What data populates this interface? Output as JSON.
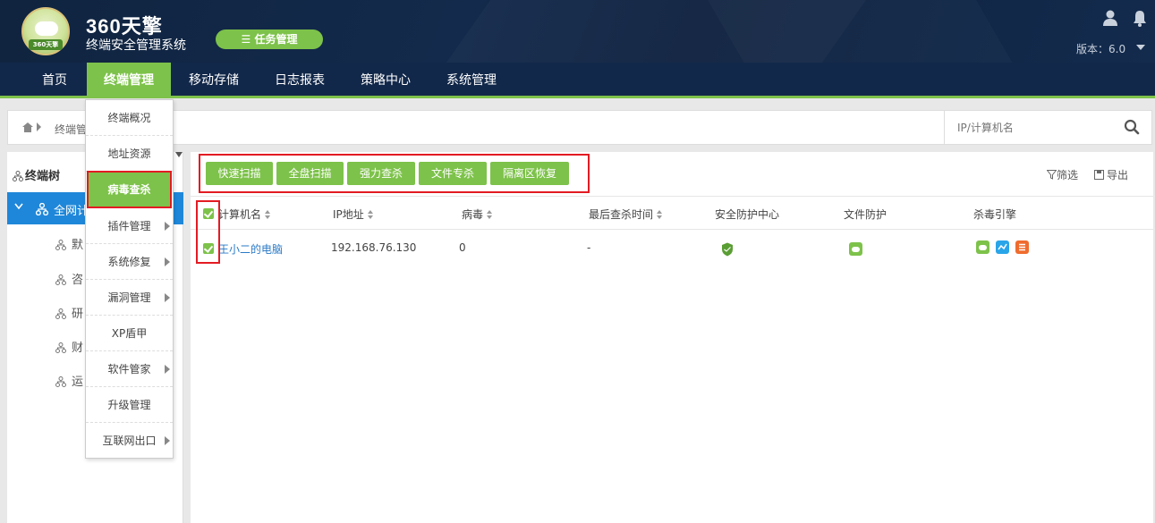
{
  "header": {
    "brand_main": "360天擎",
    "brand_sub": "终端安全管理系统",
    "badge_text": "360天擎",
    "task_button": "任务管理",
    "version": "版本：6.0"
  },
  "nav": {
    "items": [
      {
        "label": "首页"
      },
      {
        "label": "终端管理"
      },
      {
        "label": "移动存储"
      },
      {
        "label": "日志报表"
      },
      {
        "label": "策略中心"
      },
      {
        "label": "系统管理"
      }
    ],
    "active": "终端管理"
  },
  "breadcrumb": {
    "text": "终端管"
  },
  "search": {
    "placeholder": "IP/计算机名"
  },
  "sidebar": {
    "title": "终端树",
    "selected": "全网计",
    "items": [
      {
        "label": "默"
      },
      {
        "label": "咨"
      },
      {
        "label": "研"
      },
      {
        "label": "财"
      },
      {
        "label": "运"
      }
    ]
  },
  "dropdown": {
    "items": [
      {
        "label": "终端概况"
      },
      {
        "label": "地址资源"
      },
      {
        "label": "病毒查杀"
      },
      {
        "label": "插件管理"
      },
      {
        "label": "系统修复"
      },
      {
        "label": "漏洞管理"
      },
      {
        "label": "XP盾甲"
      },
      {
        "label": "软件管家"
      },
      {
        "label": "升级管理"
      },
      {
        "label": "互联网出口"
      }
    ],
    "selected": "病毒查杀"
  },
  "toolbar": {
    "buttons": [
      {
        "label": "快速扫描"
      },
      {
        "label": "全盘扫描"
      },
      {
        "label": "强力查杀"
      },
      {
        "label": "文件专杀"
      },
      {
        "label": "隔离区恢复"
      }
    ],
    "filter": "筛选",
    "export": "导出"
  },
  "table": {
    "columns": [
      "计算机名",
      "IP地址",
      "病毒",
      "最后查杀时间",
      "安全防护中心",
      "文件防护",
      "杀毒引擎"
    ],
    "rows": [
      {
        "name": "王小二的电脑",
        "ip": "192.168.76.130",
        "virus": "0",
        "last_scan": "-",
        "checked": true
      }
    ]
  },
  "colors": {
    "accent_green": "#7dc24a",
    "nav_bg": "#12284a",
    "tree_selected": "#1f87d9",
    "highlight_red": "#e31b23",
    "link_blue": "#2a7ac7"
  }
}
